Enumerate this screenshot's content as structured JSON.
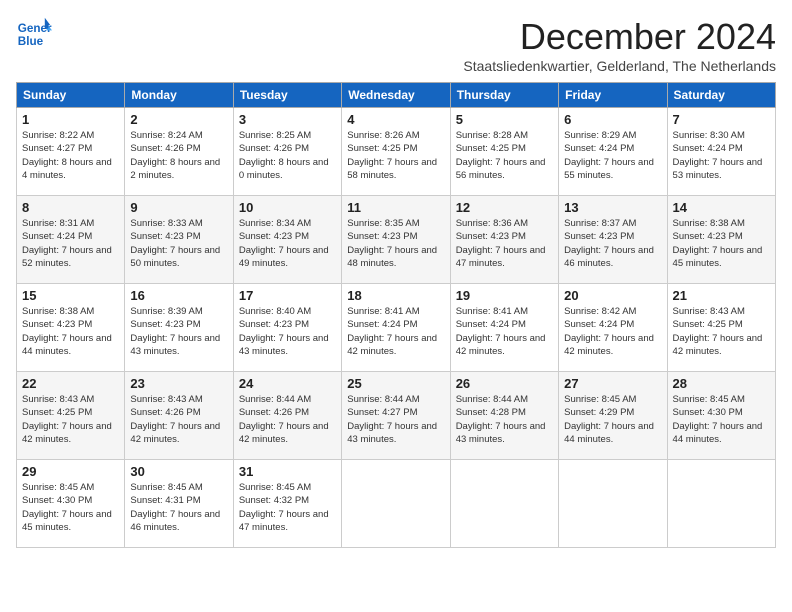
{
  "logo": {
    "line1": "General",
    "line2": "Blue"
  },
  "title": "December 2024",
  "subtitle": "Staatsliedenkwartier, Gelderland, The Netherlands",
  "days_of_week": [
    "Sunday",
    "Monday",
    "Tuesday",
    "Wednesday",
    "Thursday",
    "Friday",
    "Saturday"
  ],
  "weeks": [
    [
      {
        "day": "1",
        "sunrise": "Sunrise: 8:22 AM",
        "sunset": "Sunset: 4:27 PM",
        "daylight": "Daylight: 8 hours and 4 minutes."
      },
      {
        "day": "2",
        "sunrise": "Sunrise: 8:24 AM",
        "sunset": "Sunset: 4:26 PM",
        "daylight": "Daylight: 8 hours and 2 minutes."
      },
      {
        "day": "3",
        "sunrise": "Sunrise: 8:25 AM",
        "sunset": "Sunset: 4:26 PM",
        "daylight": "Daylight: 8 hours and 0 minutes."
      },
      {
        "day": "4",
        "sunrise": "Sunrise: 8:26 AM",
        "sunset": "Sunset: 4:25 PM",
        "daylight": "Daylight: 7 hours and 58 minutes."
      },
      {
        "day": "5",
        "sunrise": "Sunrise: 8:28 AM",
        "sunset": "Sunset: 4:25 PM",
        "daylight": "Daylight: 7 hours and 56 minutes."
      },
      {
        "day": "6",
        "sunrise": "Sunrise: 8:29 AM",
        "sunset": "Sunset: 4:24 PM",
        "daylight": "Daylight: 7 hours and 55 minutes."
      },
      {
        "day": "7",
        "sunrise": "Sunrise: 8:30 AM",
        "sunset": "Sunset: 4:24 PM",
        "daylight": "Daylight: 7 hours and 53 minutes."
      }
    ],
    [
      {
        "day": "8",
        "sunrise": "Sunrise: 8:31 AM",
        "sunset": "Sunset: 4:24 PM",
        "daylight": "Daylight: 7 hours and 52 minutes."
      },
      {
        "day": "9",
        "sunrise": "Sunrise: 8:33 AM",
        "sunset": "Sunset: 4:23 PM",
        "daylight": "Daylight: 7 hours and 50 minutes."
      },
      {
        "day": "10",
        "sunrise": "Sunrise: 8:34 AM",
        "sunset": "Sunset: 4:23 PM",
        "daylight": "Daylight: 7 hours and 49 minutes."
      },
      {
        "day": "11",
        "sunrise": "Sunrise: 8:35 AM",
        "sunset": "Sunset: 4:23 PM",
        "daylight": "Daylight: 7 hours and 48 minutes."
      },
      {
        "day": "12",
        "sunrise": "Sunrise: 8:36 AM",
        "sunset": "Sunset: 4:23 PM",
        "daylight": "Daylight: 7 hours and 47 minutes."
      },
      {
        "day": "13",
        "sunrise": "Sunrise: 8:37 AM",
        "sunset": "Sunset: 4:23 PM",
        "daylight": "Daylight: 7 hours and 46 minutes."
      },
      {
        "day": "14",
        "sunrise": "Sunrise: 8:38 AM",
        "sunset": "Sunset: 4:23 PM",
        "daylight": "Daylight: 7 hours and 45 minutes."
      }
    ],
    [
      {
        "day": "15",
        "sunrise": "Sunrise: 8:38 AM",
        "sunset": "Sunset: 4:23 PM",
        "daylight": "Daylight: 7 hours and 44 minutes."
      },
      {
        "day": "16",
        "sunrise": "Sunrise: 8:39 AM",
        "sunset": "Sunset: 4:23 PM",
        "daylight": "Daylight: 7 hours and 43 minutes."
      },
      {
        "day": "17",
        "sunrise": "Sunrise: 8:40 AM",
        "sunset": "Sunset: 4:23 PM",
        "daylight": "Daylight: 7 hours and 43 minutes."
      },
      {
        "day": "18",
        "sunrise": "Sunrise: 8:41 AM",
        "sunset": "Sunset: 4:24 PM",
        "daylight": "Daylight: 7 hours and 42 minutes."
      },
      {
        "day": "19",
        "sunrise": "Sunrise: 8:41 AM",
        "sunset": "Sunset: 4:24 PM",
        "daylight": "Daylight: 7 hours and 42 minutes."
      },
      {
        "day": "20",
        "sunrise": "Sunrise: 8:42 AM",
        "sunset": "Sunset: 4:24 PM",
        "daylight": "Daylight: 7 hours and 42 minutes."
      },
      {
        "day": "21",
        "sunrise": "Sunrise: 8:43 AM",
        "sunset": "Sunset: 4:25 PM",
        "daylight": "Daylight: 7 hours and 42 minutes."
      }
    ],
    [
      {
        "day": "22",
        "sunrise": "Sunrise: 8:43 AM",
        "sunset": "Sunset: 4:25 PM",
        "daylight": "Daylight: 7 hours and 42 minutes."
      },
      {
        "day": "23",
        "sunrise": "Sunrise: 8:43 AM",
        "sunset": "Sunset: 4:26 PM",
        "daylight": "Daylight: 7 hours and 42 minutes."
      },
      {
        "day": "24",
        "sunrise": "Sunrise: 8:44 AM",
        "sunset": "Sunset: 4:26 PM",
        "daylight": "Daylight: 7 hours and 42 minutes."
      },
      {
        "day": "25",
        "sunrise": "Sunrise: 8:44 AM",
        "sunset": "Sunset: 4:27 PM",
        "daylight": "Daylight: 7 hours and 43 minutes."
      },
      {
        "day": "26",
        "sunrise": "Sunrise: 8:44 AM",
        "sunset": "Sunset: 4:28 PM",
        "daylight": "Daylight: 7 hours and 43 minutes."
      },
      {
        "day": "27",
        "sunrise": "Sunrise: 8:45 AM",
        "sunset": "Sunset: 4:29 PM",
        "daylight": "Daylight: 7 hours and 44 minutes."
      },
      {
        "day": "28",
        "sunrise": "Sunrise: 8:45 AM",
        "sunset": "Sunset: 4:30 PM",
        "daylight": "Daylight: 7 hours and 44 minutes."
      }
    ],
    [
      {
        "day": "29",
        "sunrise": "Sunrise: 8:45 AM",
        "sunset": "Sunset: 4:30 PM",
        "daylight": "Daylight: 7 hours and 45 minutes."
      },
      {
        "day": "30",
        "sunrise": "Sunrise: 8:45 AM",
        "sunset": "Sunset: 4:31 PM",
        "daylight": "Daylight: 7 hours and 46 minutes."
      },
      {
        "day": "31",
        "sunrise": "Sunrise: 8:45 AM",
        "sunset": "Sunset: 4:32 PM",
        "daylight": "Daylight: 7 hours and 47 minutes."
      },
      null,
      null,
      null,
      null
    ]
  ]
}
